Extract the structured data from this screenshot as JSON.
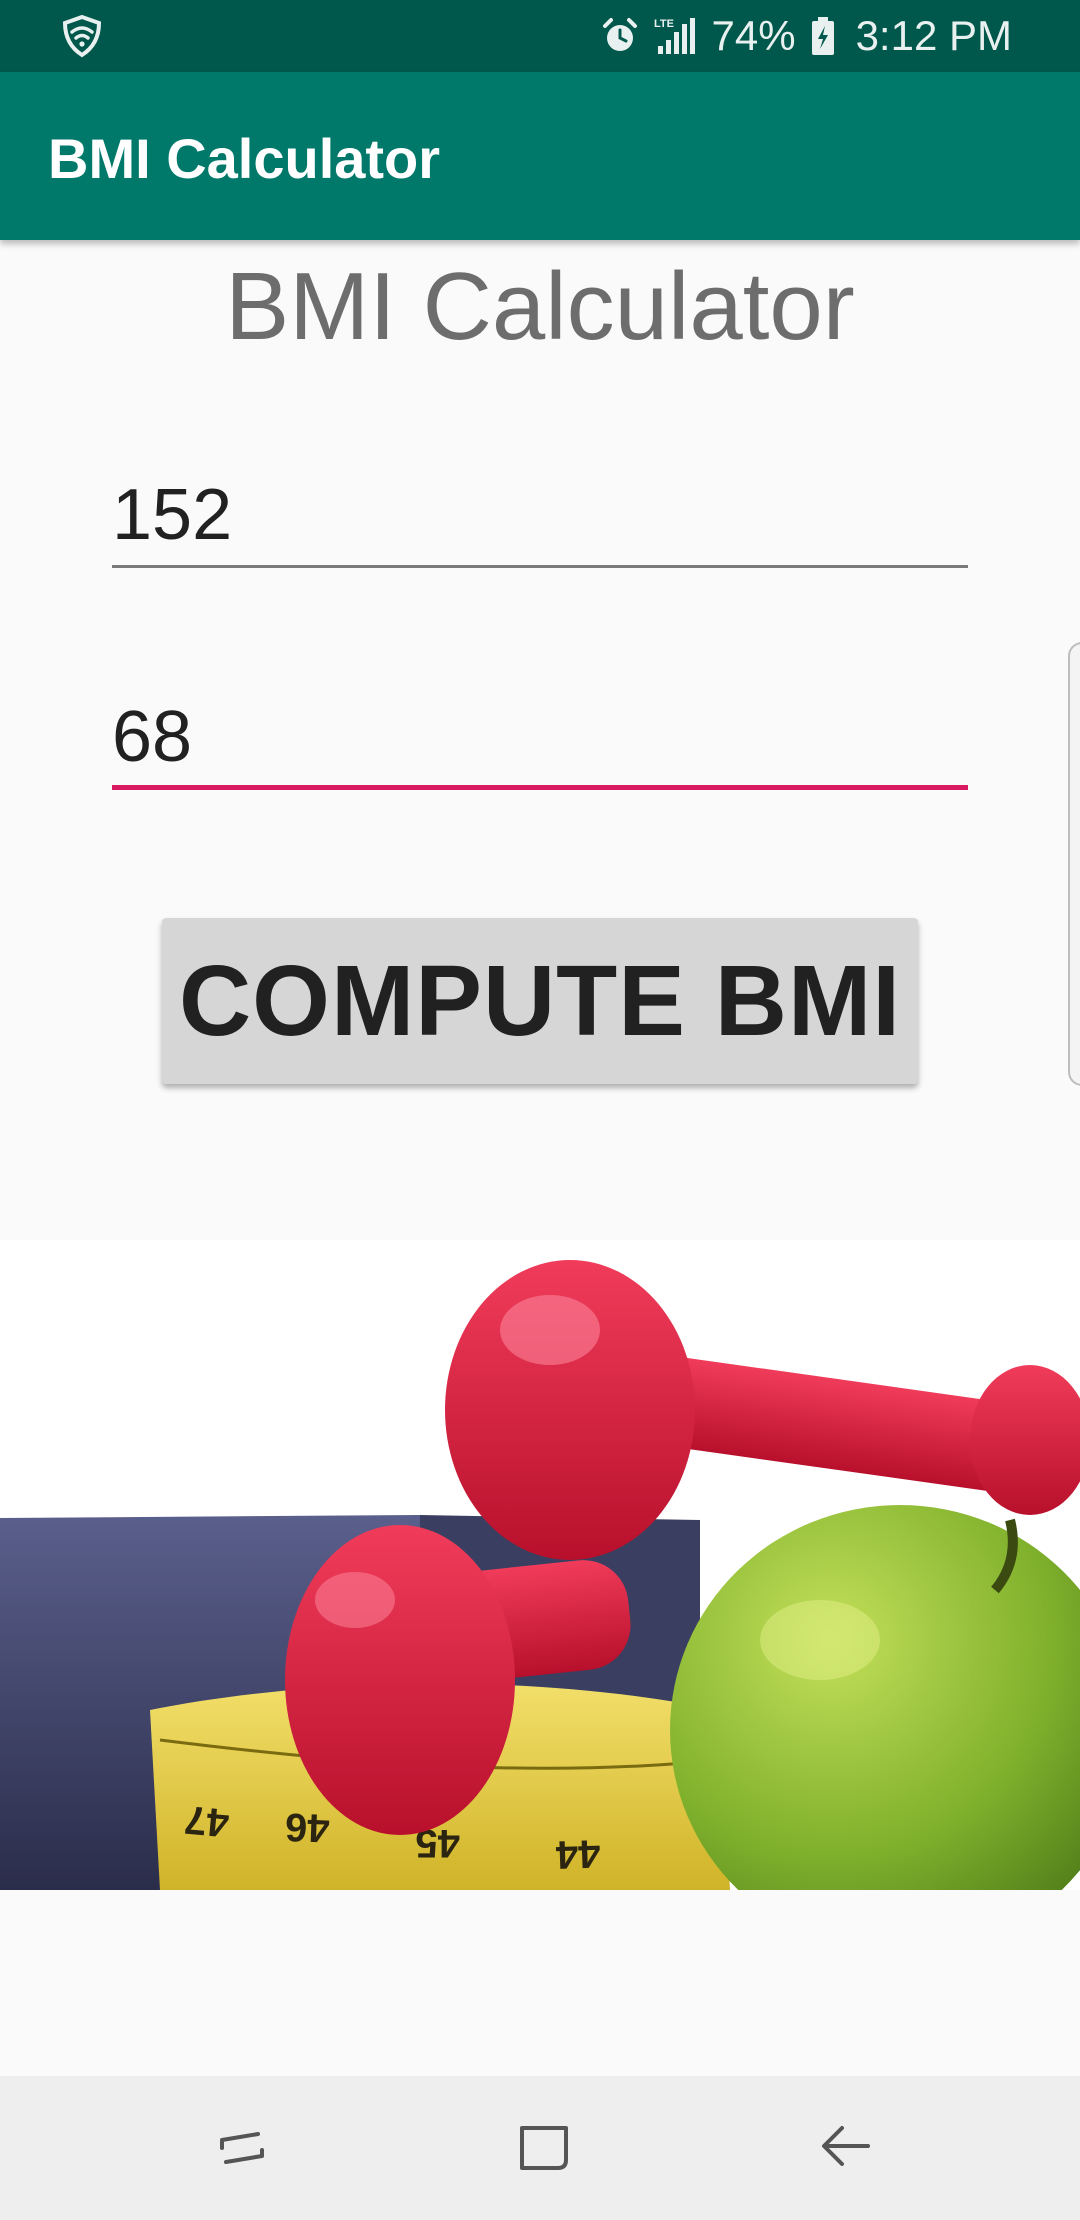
{
  "status_bar": {
    "battery_percent": "74%",
    "time": "3:12 PM",
    "network_label": "LTE",
    "icons": [
      "shield-icon",
      "alarm-icon",
      "signal-icon",
      "battery-icon"
    ]
  },
  "app_bar": {
    "title": "BMI Calculator"
  },
  "main": {
    "title": "BMI Calculator",
    "height_input": {
      "value": "152"
    },
    "weight_input": {
      "value": "68"
    },
    "compute_button_label": "COMPUTE BMI",
    "hero_image": {
      "icon": "fitness-image"
    }
  },
  "nav_bar": {
    "icons": [
      "recents-icon",
      "home-icon",
      "back-icon"
    ]
  },
  "colors": {
    "status_bar": "#00574b",
    "app_bar": "#00796b",
    "accent": "#d81b60",
    "button": "#d6d6d6"
  }
}
